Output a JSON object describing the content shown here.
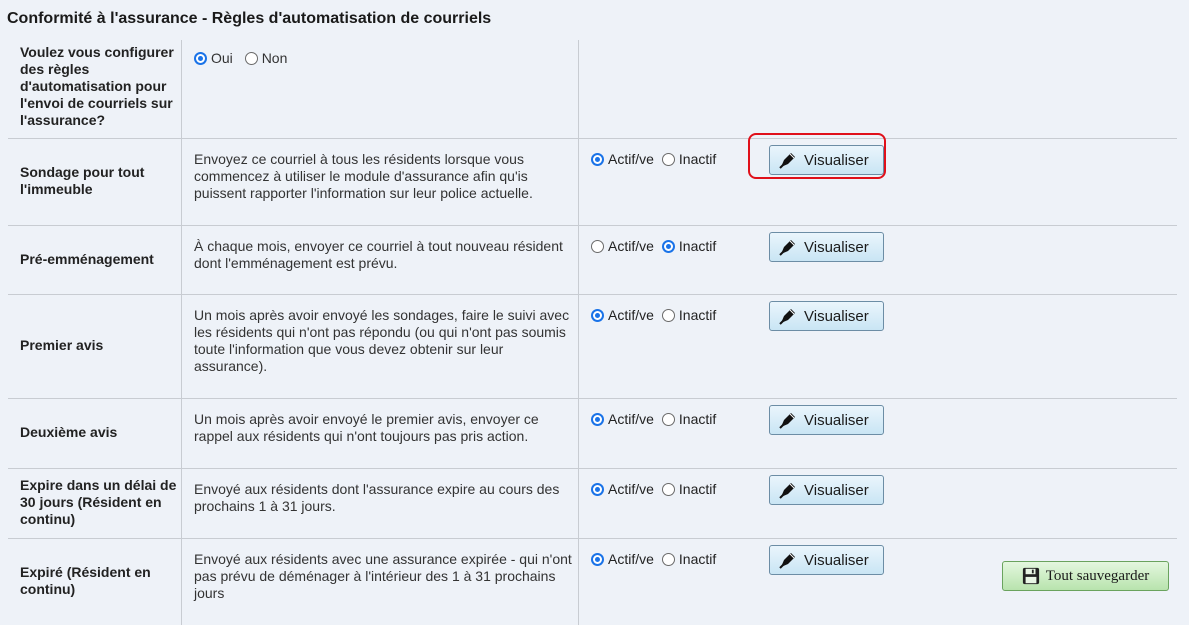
{
  "page": {
    "title": "Conformité à l'assurance - Règles d'automatisation de courriels"
  },
  "question": {
    "label": "Voulez vous configurer des règles d'automatisation pour l'envoi de courriels sur l'assurance?",
    "yes_label": "Oui",
    "no_label": "Non",
    "selected": "Oui"
  },
  "rules": [
    {
      "name": "Sondage pour tout l'immeuble",
      "description": "Envoyez ce courriel à tous les résidents lorsque vous commencez à utiliser le module d'assurance afin qu'is puissent rapporter l'information sur leur police actuelle.",
      "status": "active"
    },
    {
      "name": "Pré-emménagement",
      "description": "À chaque mois, envoyer ce courriel à tout nouveau résident dont l'emménagement est prévu.",
      "status": "inactive"
    },
    {
      "name": "Premier avis",
      "description": "Un mois après avoir envoyé les sondages, faire le suivi avec les résidents qui n'ont pas répondu (ou qui n'ont pas soumis toute l'information que vous devez obtenir sur leur assurance).",
      "status": "active"
    },
    {
      "name": "Deuxième avis",
      "description": "Un mois après avoir envoyé le premier avis, envoyer ce rappel aux résidents qui n'ont toujours pas pris action.",
      "status": "active"
    },
    {
      "name": "Expire dans un délai de 30 jours (Résident en continu)",
      "description": "Envoyé aux résidents dont l'assurance expire au cours des prochains 1 à 31 jours.",
      "status": "active"
    },
    {
      "name": "Expiré (Résident en continu)",
      "description": "Envoyé aux résidents avec une assurance expirée - qui n'ont pas prévu de déménager à l'intérieur des 1 à 31 prochains jours",
      "status": "active"
    }
  ],
  "labels": {
    "active": "Actif/ve",
    "inactive": "Inactif",
    "view_button": "Visualiser",
    "save_all": "Tout sauvegarder"
  },
  "colors": {
    "highlight": "#e0101a",
    "radio_selected": "#1a73e8",
    "save_button": "#b8e3ad",
    "view_button": "#c9e5f4"
  }
}
